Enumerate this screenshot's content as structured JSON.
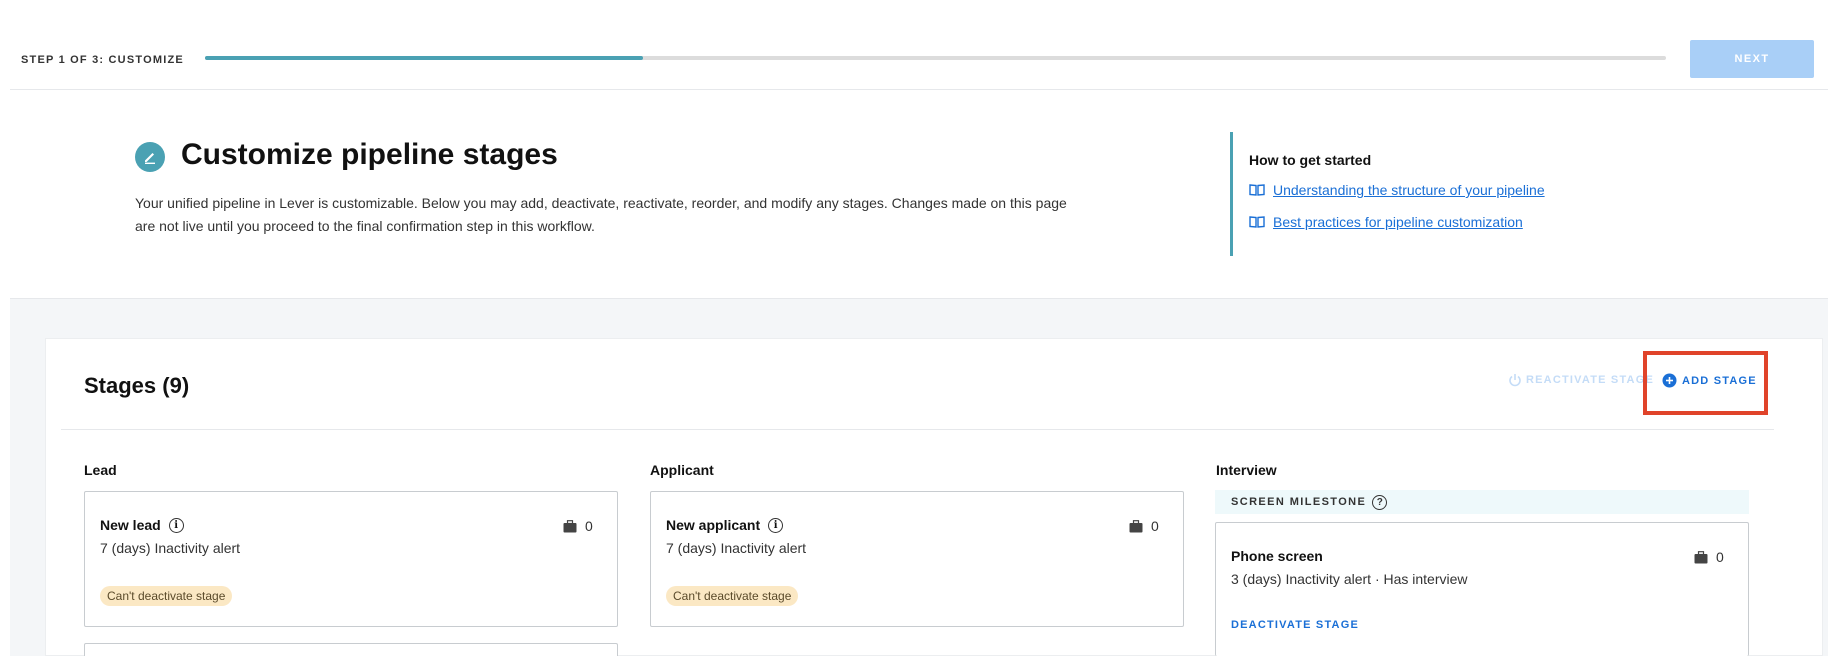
{
  "step": {
    "label": "STEP 1 OF 3: CUSTOMIZE",
    "progress_fraction": 0.3,
    "next_label": "NEXT"
  },
  "header": {
    "title": "Customize pipeline stages",
    "description": "Your unified pipeline in Lever is customizable. Below you may add, deactivate, reactivate, reorder, and modify any stages. Changes made on this page are not live until you proceed to the final confirmation step in this workflow.",
    "icon": "edit-pencil-icon"
  },
  "help": {
    "title": "How to get started",
    "links": [
      {
        "label": "Understanding the structure of your pipeline",
        "icon": "book-icon"
      },
      {
        "label": "Best practices for pipeline customization",
        "icon": "book-icon"
      }
    ]
  },
  "stages": {
    "title": "Stages (9)",
    "reactivate_label": "REACTIVATE STAGE",
    "add_label": "ADD STAGE",
    "columns": [
      {
        "label": "Lead",
        "cards": [
          {
            "title": "New lead",
            "subtitle": "7 (days) Inactivity alert",
            "count": "0",
            "badge": "Can't deactivate stage"
          }
        ]
      },
      {
        "label": "Applicant",
        "cards": [
          {
            "title": "New applicant",
            "subtitle": "7 (days) Inactivity alert",
            "count": "0",
            "badge": "Can't deactivate stage"
          }
        ]
      },
      {
        "label": "Interview",
        "milestone": "SCREEN MILESTONE",
        "cards": [
          {
            "title": "Phone screen",
            "subtitle": "3 (days) Inactivity alert · Has interview",
            "count": "0",
            "action": "DEACTIVATE STAGE"
          }
        ]
      }
    ]
  },
  "colors": {
    "accent": "#4aa1b3",
    "link": "#1a6fd6",
    "highlight": "#e0432a",
    "badge_bg": "#fbe8c4"
  }
}
